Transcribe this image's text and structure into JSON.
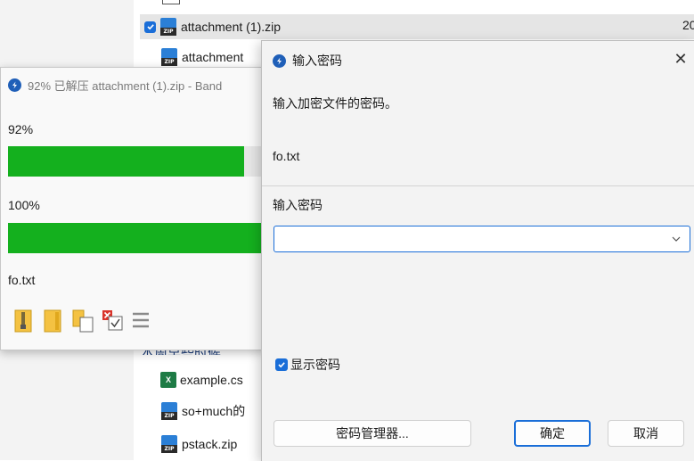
{
  "explorer": {
    "files": [
      {
        "name": "attachment (1).zip",
        "type": "zip"
      },
      {
        "name": "attachment",
        "type": "zip"
      },
      {
        "name": "example.cs",
        "type": "xls"
      },
      {
        "name": "so+much的",
        "type": "zip"
      },
      {
        "name": "pstack.zip",
        "type": "zip"
      }
    ],
    "partial_size": "20",
    "partial_group_text": "本周早些时候"
  },
  "progress_window": {
    "title": "92% 已解压 attachment (1).zip - Band",
    "bar1_label": "92%",
    "bar1_value": 0.92,
    "bar2_label": "100%",
    "bar2_value": 1.0,
    "current_file": "fo.txt",
    "colors": {
      "bar_fill": "#14b01e"
    },
    "toolbar_icons": [
      "folder-zip-icon",
      "folder-icon",
      "copy-files-icon",
      "delete-check-icon",
      "menu-icon"
    ]
  },
  "dialog": {
    "title": "输入密码",
    "prompt": "输入加密文件的密码。",
    "file_name": "fo.txt",
    "password_label": "输入密码",
    "password_value": "",
    "show_password_label": "显示密码",
    "show_password_checked": true,
    "password_manager_button": "密码管理器...",
    "ok_button": "确定",
    "cancel_button": "取消",
    "colors": {
      "accent": "#1a6ed8"
    }
  }
}
